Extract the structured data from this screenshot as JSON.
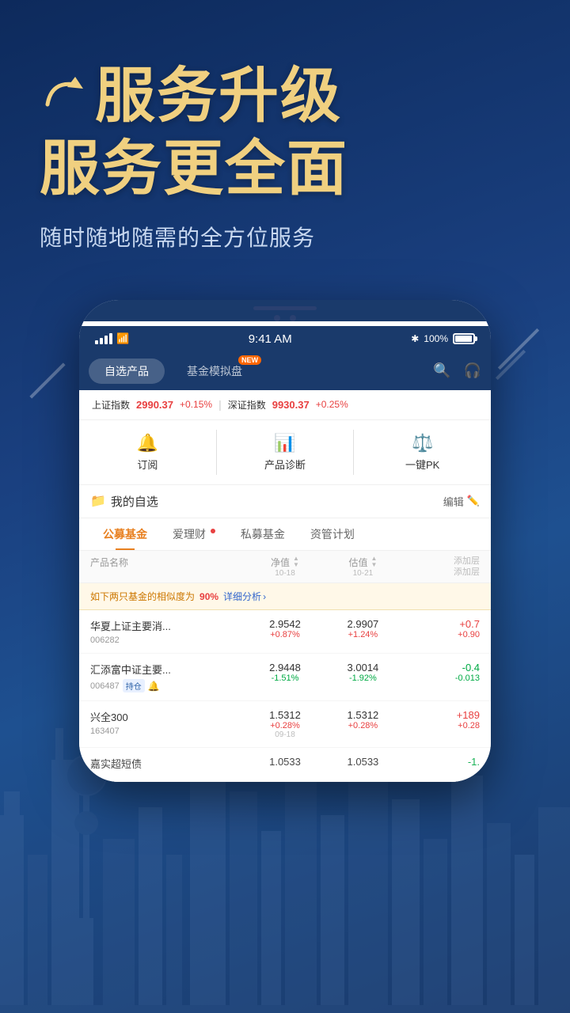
{
  "hero": {
    "title_line1": "服务升级",
    "title_line2": "服务更全面",
    "subtitle": "随时随地随需的全方位服务"
  },
  "phone": {
    "status_bar": {
      "time": "9:41 AM",
      "battery": "100%"
    },
    "nav_tabs": [
      {
        "label": "自选产品",
        "active": true
      },
      {
        "label": "基金模拟盘",
        "active": false,
        "badge": "NEW"
      }
    ]
  },
  "market": {
    "shanghai_label": "上证指数",
    "shanghai_value": "2990.37",
    "shanghai_change": "+0.15%",
    "shenzhen_label": "深证指数",
    "shenzhen_value": "9930.37",
    "shenzhen_change": "+0.25%"
  },
  "quick_actions": [
    {
      "label": "订阅"
    },
    {
      "label": "产品诊断"
    },
    {
      "label": "一键PK"
    }
  ],
  "section": {
    "title": "我的自选",
    "edit_label": "编辑"
  },
  "fund_tabs": [
    {
      "label": "公募基金",
      "active": true
    },
    {
      "label": "爱理财",
      "has_dot": true
    },
    {
      "label": "私募基金"
    },
    {
      "label": "资管计划"
    }
  ],
  "table_header": {
    "col_name": "产品名称",
    "col_nav": "净值",
    "col_nav_date": "10-18",
    "col_estimate": "估值",
    "col_estimate_date": "10-21",
    "col_add": "添加层\n添加层"
  },
  "warning": {
    "text1": "如下两只基金的相似度为",
    "percent": "90%",
    "link": "详细分析"
  },
  "funds": [
    {
      "name": "华夏上证主要消...",
      "code": "006282",
      "nav_value": "2.9542",
      "nav_change": "+0.87%",
      "nav_change_type": "up",
      "est_value": "2.9907",
      "est_change": "+1.24%",
      "est_change_type": "up",
      "right_value": "+0.7",
      "right_value2": "+0.90",
      "right_type": "up",
      "tags": [],
      "has_bell": false
    },
    {
      "name": "汇添富中证主要...",
      "code": "006487",
      "nav_value": "2.9448",
      "nav_change": "-1.51%",
      "nav_change_type": "down",
      "est_value": "3.0014",
      "est_change": "-1.92%",
      "est_change_type": "down",
      "right_value": "-0.4",
      "right_value2": "-0.013",
      "right_type": "down",
      "tags": [
        "持仓"
      ],
      "has_bell": true
    },
    {
      "name": "兴全300",
      "code": "163407",
      "nav_value": "1.5312",
      "nav_change": "+0.28%",
      "nav_change_type": "up",
      "est_value": "1.5312",
      "est_change": "+0.28%",
      "est_change_type": "up",
      "right_value": "+189",
      "right_value2": "+0.28",
      "right_type": "up",
      "fund_date": "09-18",
      "tags": [],
      "has_bell": false
    },
    {
      "name": "嘉实超短债",
      "code": "",
      "nav_value": "1.0533",
      "nav_change": "",
      "est_value": "1.0533",
      "est_change": "",
      "right_value": "-1.",
      "right_value2": "",
      "right_type": "down",
      "tags": [],
      "has_bell": false
    }
  ]
}
